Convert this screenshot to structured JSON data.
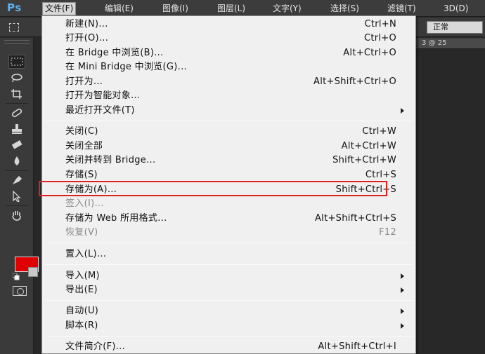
{
  "app": {
    "logo": "Ps"
  },
  "menubar": {
    "items": [
      {
        "label": "文件(F)"
      },
      {
        "label": "编辑(E)"
      },
      {
        "label": "图像(I)"
      },
      {
        "label": "图层(L)"
      },
      {
        "label": "文字(Y)"
      },
      {
        "label": "选择(S)"
      },
      {
        "label": "滤镜(T)"
      },
      {
        "label": "3D(D)"
      }
    ],
    "active_index": 0
  },
  "options_bar": {
    "blend_mode": "正常"
  },
  "doc_tab": {
    "label": "3 @ 25"
  },
  "toolbox": {
    "tools": [
      {
        "icon": "rect-marquee-icon"
      },
      {
        "icon": "lasso-icon"
      },
      {
        "icon": "crop-icon"
      },
      {
        "icon": "spot-healing-icon"
      },
      {
        "icon": "stamp-icon"
      },
      {
        "icon": "eraser-icon"
      },
      {
        "icon": "blur-icon"
      },
      {
        "icon": "pen-icon"
      },
      {
        "icon": "path-select-icon"
      },
      {
        "icon": "hand-icon"
      }
    ],
    "foreground_color": "#e00000",
    "background_color": "#c9c9c9"
  },
  "file_menu": {
    "items": [
      {
        "label": "新建(N)...",
        "shortcut": "Ctrl+N"
      },
      {
        "label": "打开(O)...",
        "shortcut": "Ctrl+O"
      },
      {
        "label": "在 Bridge 中浏览(B)...",
        "shortcut": "Alt+Ctrl+O"
      },
      {
        "label": "在 Mini Bridge 中浏览(G)...",
        "shortcut": ""
      },
      {
        "label": "打开为...",
        "shortcut": "Alt+Shift+Ctrl+O"
      },
      {
        "label": "打开为智能对象...",
        "shortcut": ""
      },
      {
        "label": "最近打开文件(T)",
        "shortcut": "",
        "submenu": true
      },
      {
        "label": "关闭(C)",
        "shortcut": "Ctrl+W"
      },
      {
        "label": "关闭全部",
        "shortcut": "Alt+Ctrl+W"
      },
      {
        "label": "关闭并转到 Bridge...",
        "shortcut": "Shift+Ctrl+W"
      },
      {
        "label": "存储(S)",
        "shortcut": "Ctrl+S"
      },
      {
        "label": "存储为(A)...",
        "shortcut": "Shift+Ctrl+S",
        "highlighted": true
      },
      {
        "label": "签入(I)...",
        "shortcut": "",
        "disabled": true
      },
      {
        "label": "存储为 Web 所用格式...",
        "shortcut": "Alt+Shift+Ctrl+S"
      },
      {
        "label": "恢复(V)",
        "shortcut": "F12",
        "disabled": true
      },
      {
        "label": "置入(L)...",
        "shortcut": ""
      },
      {
        "label": "导入(M)",
        "shortcut": "",
        "submenu": true
      },
      {
        "label": "导出(E)",
        "shortcut": "",
        "submenu": true
      },
      {
        "label": "自动(U)",
        "shortcut": "",
        "submenu": true
      },
      {
        "label": "脚本(R)",
        "shortcut": "",
        "submenu": true
      },
      {
        "label": "文件简介(F)...",
        "shortcut": "Alt+Shift+Ctrl+I"
      }
    ]
  },
  "colors": {
    "highlight_border": "#e02020",
    "menu_bg": "#f0f0f0",
    "ps_blue": "#5ab2f0"
  }
}
